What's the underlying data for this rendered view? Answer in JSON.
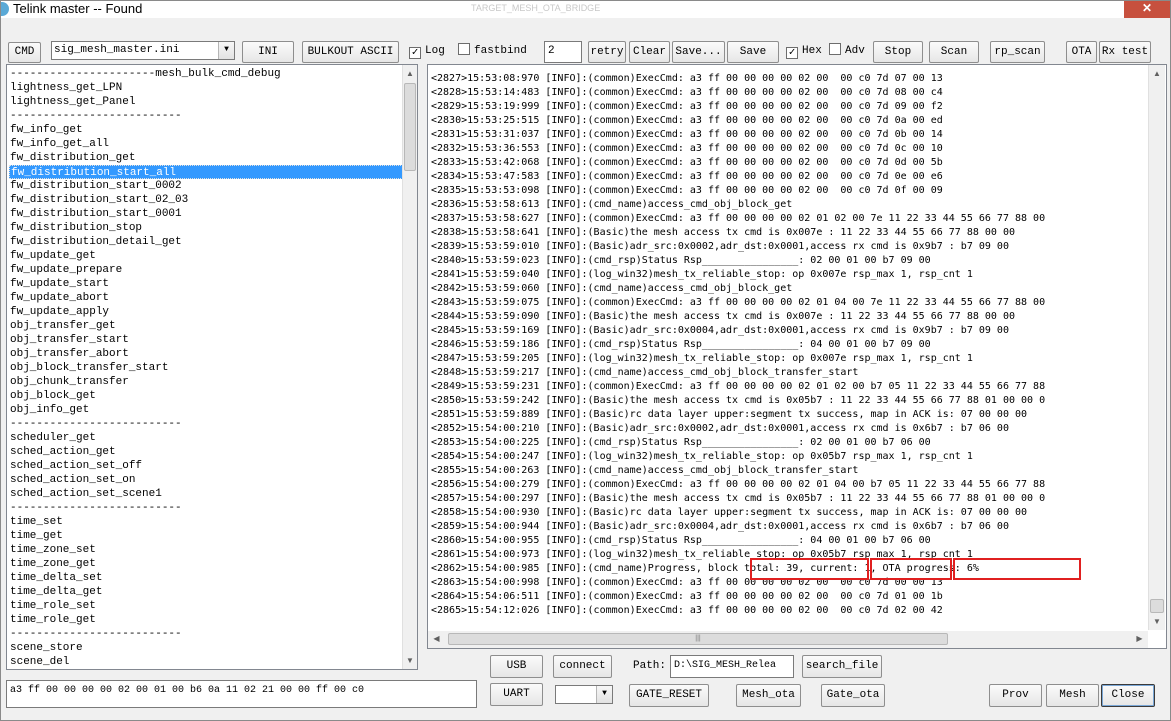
{
  "window": {
    "title": "Telink master -- Found",
    "title_ghost": "TARGET_MESH_OTA_BRIDGE",
    "close_glyph": "✕"
  },
  "toolbar": {
    "cmd_label": "CMD",
    "ini_file": "sig_mesh_master.ini",
    "ini_label": "INI",
    "bulkout_label": "BULKOUT ASCII",
    "log_label": "Log",
    "log_checked": true,
    "fastbind_label": "fastbind",
    "fastbind_checked": false,
    "retry_count": "2",
    "retry_label": "retry",
    "clear_label": "Clear",
    "save_dots_label": "Save...",
    "save_label": "Save",
    "hex_label": "Hex",
    "hex_checked": true,
    "adv_label": "Adv",
    "adv_checked": false,
    "stop_label": "Stop",
    "scan_label": "Scan",
    "rp_scan_label": "rp_scan",
    "ota_label": "OTA",
    "rx_test_label": "Rx test"
  },
  "cmd_list": {
    "selected_index": 7,
    "items": [
      "----------------------mesh_bulk_cmd_debug",
      "lightness_get_LPN",
      "lightness_get_Panel",
      "--------------------------",
      "fw_info_get",
      "fw_info_get_all",
      "fw_distribution_get",
      "fw_distribution_start_all",
      "fw_distribution_start_0002",
      "fw_distribution_start_02_03",
      "fw_distribution_start_0001",
      "fw_distribution_stop",
      "fw_distribution_detail_get",
      "fw_update_get",
      "fw_update_prepare",
      "fw_update_start",
      "fw_update_abort",
      "fw_update_apply",
      "obj_transfer_get",
      "obj_transfer_start",
      "obj_transfer_abort",
      "obj_block_transfer_start",
      "obj_chunk_transfer",
      "obj_block_get",
      "obj_info_get",
      "--------------------------",
      "scheduler_get",
      "sched_action_get",
      "sched_action_set_off",
      "sched_action_set_on",
      "sched_action_set_scene1",
      "--------------------------",
      "time_set",
      "time_get",
      "time_zone_set",
      "time_zone_get",
      "time_delta_set",
      "time_delta_get",
      "time_role_set",
      "time_role_get",
      "--------------------------",
      "scene_store",
      "scene_del"
    ]
  },
  "log": {
    "lines": [
      "<2827>15:53:08:970 [INFO]:(common)ExecCmd: a3 ff 00 00 00 00 02 00  00 c0 7d 07 00 13",
      "<2828>15:53:14:483 [INFO]:(common)ExecCmd: a3 ff 00 00 00 00 02 00  00 c0 7d 08 00 c4",
      "<2829>15:53:19:999 [INFO]:(common)ExecCmd: a3 ff 00 00 00 00 02 00  00 c0 7d 09 00 f2",
      "<2830>15:53:25:515 [INFO]:(common)ExecCmd: a3 ff 00 00 00 00 02 00  00 c0 7d 0a 00 ed",
      "<2831>15:53:31:037 [INFO]:(common)ExecCmd: a3 ff 00 00 00 00 02 00  00 c0 7d 0b 00 14",
      "<2832>15:53:36:553 [INFO]:(common)ExecCmd: a3 ff 00 00 00 00 02 00  00 c0 7d 0c 00 10",
      "<2833>15:53:42:068 [INFO]:(common)ExecCmd: a3 ff 00 00 00 00 02 00  00 c0 7d 0d 00 5b",
      "<2834>15:53:47:583 [INFO]:(common)ExecCmd: a3 ff 00 00 00 00 02 00  00 c0 7d 0e 00 e6",
      "<2835>15:53:53:098 [INFO]:(common)ExecCmd: a3 ff 00 00 00 00 02 00  00 c0 7d 0f 00 09",
      "<2836>15:53:58:613 [INFO]:(cmd_name)access_cmd_obj_block_get",
      "<2837>15:53:58:627 [INFO]:(common)ExecCmd: a3 ff 00 00 00 00 02 01 02 00 7e 11 22 33 44 55 66 77 88 00",
      "<2838>15:53:58:641 [INFO]:(Basic)the mesh access tx cmd is 0x007e : 11 22 33 44 55 66 77 88 00 00",
      "<2839>15:53:59:010 [INFO]:(Basic)adr_src:0x0002,adr_dst:0x0001,access rx cmd is 0x9b7 : b7 09 00",
      "<2840>15:53:59:023 [INFO]:(cmd_rsp)Status Rsp________________: 02 00 01 00 b7 09 00",
      "<2841>15:53:59:040 [INFO]:(log_win32)mesh_tx_reliable_stop: op 0x007e rsp_max 1, rsp_cnt 1",
      "<2842>15:53:59:060 [INFO]:(cmd_name)access_cmd_obj_block_get",
      "<2843>15:53:59:075 [INFO]:(common)ExecCmd: a3 ff 00 00 00 00 02 01 04 00 7e 11 22 33 44 55 66 77 88 00",
      "<2844>15:53:59:090 [INFO]:(Basic)the mesh access tx cmd is 0x007e : 11 22 33 44 55 66 77 88 00 00",
      "<2845>15:53:59:169 [INFO]:(Basic)adr_src:0x0004,adr_dst:0x0001,access rx cmd is 0x9b7 : b7 09 00",
      "<2846>15:53:59:186 [INFO]:(cmd_rsp)Status Rsp________________: 04 00 01 00 b7 09 00",
      "<2847>15:53:59:205 [INFO]:(log_win32)mesh_tx_reliable_stop: op 0x007e rsp_max 1, rsp_cnt 1",
      "<2848>15:53:59:217 [INFO]:(cmd_name)access_cmd_obj_block_transfer_start",
      "<2849>15:53:59:231 [INFO]:(common)ExecCmd: a3 ff 00 00 00 00 02 01 02 00 b7 05 11 22 33 44 55 66 77 88",
      "<2850>15:53:59:242 [INFO]:(Basic)the mesh access tx cmd is 0x05b7 : 11 22 33 44 55 66 77 88 01 00 00 0",
      "<2851>15:53:59:889 [INFO]:(Basic)rc data layer upper:segment tx success, map in ACK is: 07 00 00 00",
      "<2852>15:54:00:210 [INFO]:(Basic)adr_src:0x0002,adr_dst:0x0001,access rx cmd is 0x6b7 : b7 06 00",
      "<2853>15:54:00:225 [INFO]:(cmd_rsp)Status Rsp________________: 02 00 01 00 b7 06 00",
      "<2854>15:54:00:247 [INFO]:(log_win32)mesh_tx_reliable_stop: op 0x05b7 rsp_max 1, rsp_cnt 1",
      "<2855>15:54:00:263 [INFO]:(cmd_name)access_cmd_obj_block_transfer_start",
      "<2856>15:54:00:279 [INFO]:(common)ExecCmd: a3 ff 00 00 00 00 02 01 04 00 b7 05 11 22 33 44 55 66 77 88",
      "<2857>15:54:00:297 [INFO]:(Basic)the mesh access tx cmd is 0x05b7 : 11 22 33 44 55 66 77 88 01 00 00 0",
      "<2858>15:54:00:930 [INFO]:(Basic)rc data layer upper:segment tx success, map in ACK is: 07 00 00 00",
      "<2859>15:54:00:944 [INFO]:(Basic)adr_src:0x0004,adr_dst:0x0001,access rx cmd is 0x6b7 : b7 06 00",
      "<2860>15:54:00:955 [INFO]:(cmd_rsp)Status Rsp________________: 04 00 01 00 b7 06 00",
      "<2861>15:54:00:973 [INFO]:(log_win32)mesh_tx_reliable_stop: op 0x05b7 rsp_max 1, rsp_cnt 1",
      "<2862>15:54:00:985 [INFO]:(cmd_name)Progress, block total: 39, current: 1, OTA progress: 6%",
      "<2863>15:54:00:998 [INFO]:(common)ExecCmd: a3 ff 00 00 00 00 02 00  00 c0 7d 00 00 13",
      "<2864>15:54:06:511 [INFO]:(common)ExecCmd: a3 ff 00 00 00 00 02 00  00 c0 7d 01 00 1b",
      "<2865>15:54:12:026 [INFO]:(common)ExecCmd: a3 ff 00 00 00 00 02 00  00 c0 7d 02 00 42"
    ]
  },
  "highlights": {
    "color": "#e02020",
    "block_total": "block total: 39,",
    "current": "current: 1,",
    "ota_progress": "OTA progress: 6%"
  },
  "bottom": {
    "cmd_input": "a3 ff 00 00 00 00 02 00 01 00 b6 0a 11 02 21 00 00 ff 00 c0",
    "usb_label": "USB",
    "connect_label": "connect",
    "path_label": "Path:",
    "path_value": "D:\\SIG_MESH_Relea",
    "search_file_label": "search_file",
    "uart_label": "UART",
    "uart_port": "",
    "gate_reset_label": "GATE_RESET",
    "mesh_ota_label": "Mesh_ota",
    "gate_ota_label": "Gate_ota",
    "prov_label": "Prov",
    "mesh_label": "Mesh",
    "close_label": "Close"
  },
  "colors": {
    "selection": "#3399ff",
    "window_bg": "#f0f0f0",
    "titlebar_close": "#c7503e"
  }
}
